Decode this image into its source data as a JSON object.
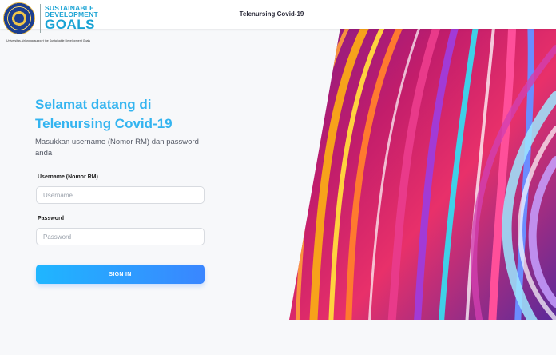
{
  "header": {
    "title": "Telenursing Covid-19"
  },
  "logo": {
    "sdg_line1": "SUSTAINABLE",
    "sdg_line2": "DEVELOPMENT",
    "sdg_goals": "GOALS",
    "caption": "Universitas Airlangga support the Sustainable Development Goals"
  },
  "login": {
    "welcome_line1": "Selamat datang di",
    "welcome_line2": "Telenursing Covid-19",
    "subtitle": "Masukkan username (Nomor RM) dan password anda",
    "username_label": "Username (Nomor RM)",
    "username_placeholder": "Username",
    "username_value": "",
    "password_label": "Password",
    "password_placeholder": "Password",
    "password_value": "",
    "signin_label": "SIGN IN"
  },
  "colors": {
    "accent": "#33b4f0",
    "button_start": "#1fb6ff",
    "button_end": "#3a86ff",
    "sdg_blue": "#1aa3d4"
  },
  "icons": {
    "seal": "university-seal-icon"
  }
}
